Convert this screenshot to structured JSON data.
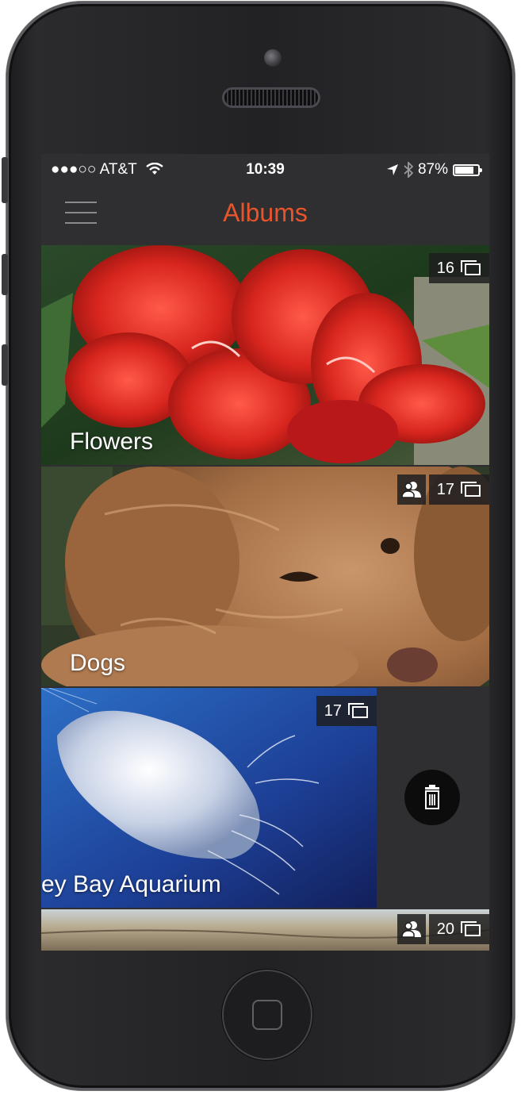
{
  "status_bar": {
    "carrier": "●●●○○ AT&T",
    "time": "10:39",
    "battery_percent": "87%",
    "battery_level": 0.87,
    "icons": [
      "wifi-icon",
      "location-arrow-icon",
      "bluetooth-icon",
      "battery-icon"
    ]
  },
  "nav": {
    "title": "Albums",
    "menu_icon": "hamburger-menu-icon"
  },
  "albums": [
    {
      "name": "Flowers",
      "count": "16",
      "shared": false,
      "theme": "red-flowers"
    },
    {
      "name": "Dogs",
      "count": "17",
      "shared": true,
      "theme": "golden-doodle"
    },
    {
      "name": "ey Bay Aquarium",
      "count": "17",
      "shared": false,
      "theme": "jellyfish",
      "swiped": true
    },
    {
      "name": "",
      "count": "20",
      "shared": true,
      "theme": "aerial-landscape"
    }
  ],
  "actions": {
    "delete_icon": "trash-icon"
  },
  "colors": {
    "accent": "#e8542b",
    "screen_bg": "#2f2f31",
    "badge_bg": "#1e1e20"
  }
}
